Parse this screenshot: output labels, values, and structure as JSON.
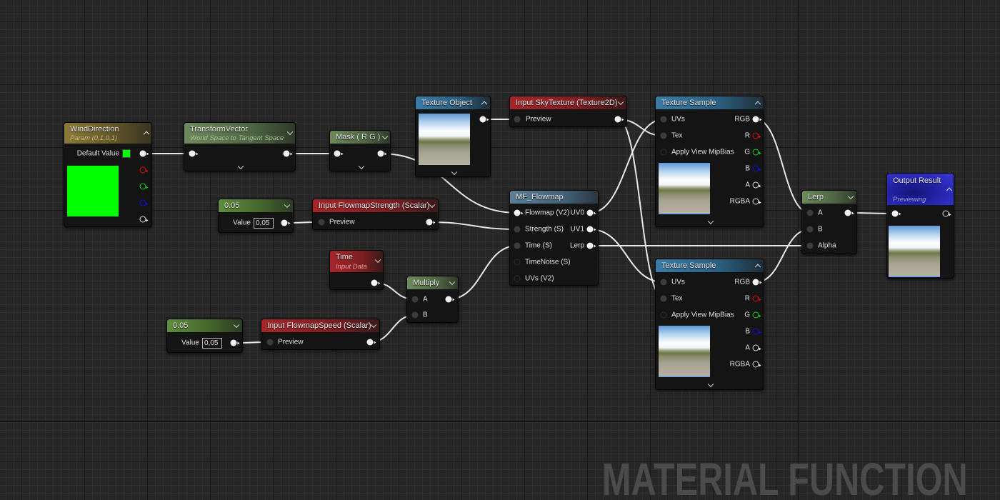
{
  "watermark": "MATERIAL FUNCTION",
  "colors": {
    "wire": "#e8e8e8",
    "param": "#8c7a38",
    "expression": "#6d8a5c",
    "texture": "#3a7ca6",
    "input": "#a4262a",
    "function_call": "#5b7f98",
    "output": "#2c2cc0",
    "swatch": "#00ff00"
  },
  "nodes": {
    "wind": {
      "title": "WindDirection",
      "subtitle": "Param (0,1,0,1)",
      "default_label": "Default Value"
    },
    "transform": {
      "title": "TransformVector",
      "subtitle": "World Space to Tangent Space"
    },
    "mask": {
      "title": "Mask ( R G )"
    },
    "texobj": {
      "title": "Texture Object"
    },
    "sky": {
      "title": "Input SkyTexture (Texture2D)",
      "pin": "Preview"
    },
    "ts1": {
      "title": "Texture Sample",
      "inputs": [
        "UVs",
        "Tex",
        "Apply View MipBias"
      ],
      "outputs": [
        "RGB",
        "R",
        "G",
        "B",
        "A",
        "RGBA"
      ]
    },
    "ts2": {
      "title": "Texture Sample",
      "inputs": [
        "UVs",
        "Tex",
        "Apply View MipBias"
      ],
      "outputs": [
        "RGB",
        "R",
        "G",
        "B",
        "A",
        "RGBA"
      ]
    },
    "mf": {
      "title": "MF_Flowmap",
      "inputs": [
        "Flowmap (V2)",
        "Strength (S)",
        "Time (S)",
        "TimeNoise (S)",
        "UVs (V2)"
      ],
      "outputs": [
        "UV0",
        "UV1",
        "Lerp"
      ]
    },
    "c1": {
      "title": "0.05",
      "value_label": "Value",
      "value": "0,05"
    },
    "strength": {
      "title": "Input FlowmapStrength (Scalar)",
      "pin": "Preview"
    },
    "time": {
      "title": "Time",
      "subtitle": "Input Data"
    },
    "multiply": {
      "title": "Multiply",
      "inputs": [
        "A",
        "B"
      ]
    },
    "c2": {
      "title": "0.05",
      "value_label": "Value",
      "value": "0,05"
    },
    "speed": {
      "title": "Input FlowmapSpeed (Scalar)",
      "pin": "Preview"
    },
    "lerp": {
      "title": "Lerp",
      "inputs": [
        "A",
        "B",
        "Alpha"
      ]
    },
    "output": {
      "title": "Output Result",
      "subtitle": "Previewing"
    }
  },
  "connections": [
    [
      "wind.out",
      "transform.in"
    ],
    [
      "transform.out",
      "mask.in"
    ],
    [
      "mask.out",
      "mf.in0"
    ],
    [
      "texobj.out",
      "sky.in"
    ],
    [
      "sky.out",
      "ts1.tex"
    ],
    [
      "sky.out",
      "ts2.tex"
    ],
    [
      "c1.out",
      "strength.in"
    ],
    [
      "strength.out",
      "mf.in1"
    ],
    [
      "time.out",
      "multiply.a"
    ],
    [
      "c2.out",
      "speed.in"
    ],
    [
      "speed.out",
      "multiply.b"
    ],
    [
      "multiply.out",
      "mf.in2"
    ],
    [
      "mf.uv0",
      "ts1.uvs"
    ],
    [
      "mf.uv1",
      "ts2.uvs"
    ],
    [
      "mf.lerp",
      "lerp.alpha"
    ],
    [
      "ts1.rgb",
      "lerp.a"
    ],
    [
      "ts2.rgb",
      "lerp.b"
    ],
    [
      "lerp.out",
      "output.in"
    ]
  ]
}
